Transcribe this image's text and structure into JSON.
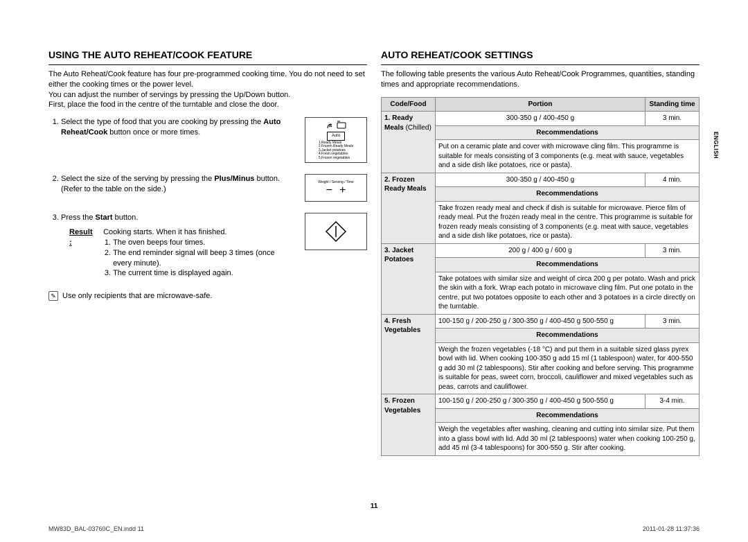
{
  "left": {
    "heading": "USING THE AUTO REHEAT/COOK FEATURE",
    "intro": "The Auto Reheat/Cook feature has four pre-programmed cooking time. You do not need to set either the cooking times or the power level.\nYou can adjust the number of servings by pressing the Up/Down button.\nFirst, place the food in the centre of the turntable and close the door.",
    "step1_a": "Select the type of food that you are cooking by pressing the ",
    "step1_b": "Auto Reheat/Cook",
    "step1_c": " button once or more times.",
    "icon1_auto": "Auto",
    "icon1_list": "1.Ready Meals\n2.Frozen Ready Meals\n3.Jacket potatoes\n4.Fresh vegetables\n5.Frozen vegetables",
    "step2_a": "Select the size of the serving by pressing the ",
    "step2_b": "Plus/Minus",
    "step2_c": " button. (Refer to the table on the side.)",
    "icon2_label": "Weight / Serving / Time",
    "step3_a": "Press the ",
    "step3_b": "Start",
    "step3_c": " button.",
    "result_label": "Result :",
    "result_intro": "Cooking starts. When it has finished.",
    "result_1": "The oven beeps four times.",
    "result_2": "The end reminder signal will beep 3 times (once every minute).",
    "result_3": "The current time is displayed again.",
    "note": "Use only recipients that are microwave-safe."
  },
  "right": {
    "heading": "AUTO REHEAT/COOK SETTINGS",
    "intro": "The following table presents the various Auto Reheat/Cook Programmes, quantities, standing times and appropriate recommendations.",
    "th_code": "Code/Food",
    "th_portion": "Portion",
    "th_standing": "Standing time",
    "rec_label": "Recommendations",
    "rows": {
      "r1_food_a": "1. Ready Meals",
      "r1_food_b": "(Chilled)",
      "r1_portion": "300-350 g / 400-450 g",
      "r1_stand": "3 min.",
      "r1_rec": "Put on a ceramic plate and cover with microwave cling film. This programme is suitable for meals consisting of 3 components (e.g. meat with sauce, vegetables and a side dish like potatoes, rice or pasta).",
      "r2_food": "2. Frozen Ready Meals",
      "r2_portion": "300-350 g / 400-450 g",
      "r2_stand": "4 min.",
      "r2_rec": "Take frozen ready meal and check if dish is suitable for microwave. Pierce film of ready meal. Put the frozen ready meal in the centre. This programme is suitable for frozen ready meals consisting of 3 components (e.g. meat with sauce, vegetables and a side dish like potatoes, rice or pasta).",
      "r3_food": "3. Jacket Potatoes",
      "r3_portion": "200 g / 400 g / 600 g",
      "r3_stand": "3 min.",
      "r3_rec": "Take potatoes with similar size and weight of circa 200 g per potato. Wash and prick the skin with a fork. Wrap each potato in microwave cling film. Put one potato in the centre, put two potatoes opposite to each other and 3 potatoes in a circle directly on the turntable.",
      "r4_food": "4. Fresh Vegetables",
      "r4_portion": "100-150 g / 200-250 g / 300-350 g / 400-450 g 500-550 g",
      "r4_stand": "3 min.",
      "r4_rec": "Weigh the frozen vegetables (-18 °C) and put them in a suitable sized glass pyrex bowl with lid. When cooking 100-350 g add 15 ml (1 tablespoon) water, for 400-550 g add 30 ml (2 tablespoons). Stir after cooking and before serving. This programme is suitable for peas, sweet corn, broccoli, cauliflower and mixed vegetables such as peas, carrots and cauliflower.",
      "r5_food": "5. Frozen Vegetables",
      "r5_portion": "100-150 g / 200-250 g / 300-350 g / 400-450 g 500-550 g",
      "r5_stand": "3-4 min.",
      "r5_rec": "Weigh the vegetables after washing, cleaning and cutting into similar size. Put them into a glass bowl with lid. Add 30 ml (2 tablespoons) water when cooking 100-250 g, add 45 ml (3-4 tablespoons) for 300-550 g. Stir after cooking."
    }
  },
  "side_tab": "ENGLISH",
  "page_num": "11",
  "footer_left": "MW83D_BAL-03760C_EN.indd   11",
  "footer_right": "2011-01-28   11:37:36"
}
